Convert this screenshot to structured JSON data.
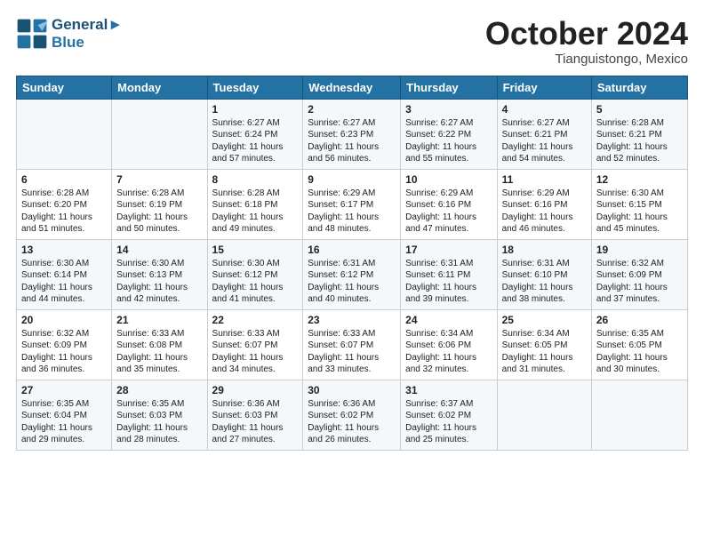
{
  "header": {
    "logo_line1": "General",
    "logo_line2": "Blue",
    "month_title": "October 2024",
    "location": "Tianguistongo, Mexico"
  },
  "weekdays": [
    "Sunday",
    "Monday",
    "Tuesday",
    "Wednesday",
    "Thursday",
    "Friday",
    "Saturday"
  ],
  "weeks": [
    [
      {
        "day": "",
        "sunrise": "",
        "sunset": "",
        "daylight": ""
      },
      {
        "day": "",
        "sunrise": "",
        "sunset": "",
        "daylight": ""
      },
      {
        "day": "1",
        "sunrise": "Sunrise: 6:27 AM",
        "sunset": "Sunset: 6:24 PM",
        "daylight": "Daylight: 11 hours and 57 minutes."
      },
      {
        "day": "2",
        "sunrise": "Sunrise: 6:27 AM",
        "sunset": "Sunset: 6:23 PM",
        "daylight": "Daylight: 11 hours and 56 minutes."
      },
      {
        "day": "3",
        "sunrise": "Sunrise: 6:27 AM",
        "sunset": "Sunset: 6:22 PM",
        "daylight": "Daylight: 11 hours and 55 minutes."
      },
      {
        "day": "4",
        "sunrise": "Sunrise: 6:27 AM",
        "sunset": "Sunset: 6:21 PM",
        "daylight": "Daylight: 11 hours and 54 minutes."
      },
      {
        "day": "5",
        "sunrise": "Sunrise: 6:28 AM",
        "sunset": "Sunset: 6:21 PM",
        "daylight": "Daylight: 11 hours and 52 minutes."
      }
    ],
    [
      {
        "day": "6",
        "sunrise": "Sunrise: 6:28 AM",
        "sunset": "Sunset: 6:20 PM",
        "daylight": "Daylight: 11 hours and 51 minutes."
      },
      {
        "day": "7",
        "sunrise": "Sunrise: 6:28 AM",
        "sunset": "Sunset: 6:19 PM",
        "daylight": "Daylight: 11 hours and 50 minutes."
      },
      {
        "day": "8",
        "sunrise": "Sunrise: 6:28 AM",
        "sunset": "Sunset: 6:18 PM",
        "daylight": "Daylight: 11 hours and 49 minutes."
      },
      {
        "day": "9",
        "sunrise": "Sunrise: 6:29 AM",
        "sunset": "Sunset: 6:17 PM",
        "daylight": "Daylight: 11 hours and 48 minutes."
      },
      {
        "day": "10",
        "sunrise": "Sunrise: 6:29 AM",
        "sunset": "Sunset: 6:16 PM",
        "daylight": "Daylight: 11 hours and 47 minutes."
      },
      {
        "day": "11",
        "sunrise": "Sunrise: 6:29 AM",
        "sunset": "Sunset: 6:16 PM",
        "daylight": "Daylight: 11 hours and 46 minutes."
      },
      {
        "day": "12",
        "sunrise": "Sunrise: 6:30 AM",
        "sunset": "Sunset: 6:15 PM",
        "daylight": "Daylight: 11 hours and 45 minutes."
      }
    ],
    [
      {
        "day": "13",
        "sunrise": "Sunrise: 6:30 AM",
        "sunset": "Sunset: 6:14 PM",
        "daylight": "Daylight: 11 hours and 44 minutes."
      },
      {
        "day": "14",
        "sunrise": "Sunrise: 6:30 AM",
        "sunset": "Sunset: 6:13 PM",
        "daylight": "Daylight: 11 hours and 42 minutes."
      },
      {
        "day": "15",
        "sunrise": "Sunrise: 6:30 AM",
        "sunset": "Sunset: 6:12 PM",
        "daylight": "Daylight: 11 hours and 41 minutes."
      },
      {
        "day": "16",
        "sunrise": "Sunrise: 6:31 AM",
        "sunset": "Sunset: 6:12 PM",
        "daylight": "Daylight: 11 hours and 40 minutes."
      },
      {
        "day": "17",
        "sunrise": "Sunrise: 6:31 AM",
        "sunset": "Sunset: 6:11 PM",
        "daylight": "Daylight: 11 hours and 39 minutes."
      },
      {
        "day": "18",
        "sunrise": "Sunrise: 6:31 AM",
        "sunset": "Sunset: 6:10 PM",
        "daylight": "Daylight: 11 hours and 38 minutes."
      },
      {
        "day": "19",
        "sunrise": "Sunrise: 6:32 AM",
        "sunset": "Sunset: 6:09 PM",
        "daylight": "Daylight: 11 hours and 37 minutes."
      }
    ],
    [
      {
        "day": "20",
        "sunrise": "Sunrise: 6:32 AM",
        "sunset": "Sunset: 6:09 PM",
        "daylight": "Daylight: 11 hours and 36 minutes."
      },
      {
        "day": "21",
        "sunrise": "Sunrise: 6:33 AM",
        "sunset": "Sunset: 6:08 PM",
        "daylight": "Daylight: 11 hours and 35 minutes."
      },
      {
        "day": "22",
        "sunrise": "Sunrise: 6:33 AM",
        "sunset": "Sunset: 6:07 PM",
        "daylight": "Daylight: 11 hours and 34 minutes."
      },
      {
        "day": "23",
        "sunrise": "Sunrise: 6:33 AM",
        "sunset": "Sunset: 6:07 PM",
        "daylight": "Daylight: 11 hours and 33 minutes."
      },
      {
        "day": "24",
        "sunrise": "Sunrise: 6:34 AM",
        "sunset": "Sunset: 6:06 PM",
        "daylight": "Daylight: 11 hours and 32 minutes."
      },
      {
        "day": "25",
        "sunrise": "Sunrise: 6:34 AM",
        "sunset": "Sunset: 6:05 PM",
        "daylight": "Daylight: 11 hours and 31 minutes."
      },
      {
        "day": "26",
        "sunrise": "Sunrise: 6:35 AM",
        "sunset": "Sunset: 6:05 PM",
        "daylight": "Daylight: 11 hours and 30 minutes."
      }
    ],
    [
      {
        "day": "27",
        "sunrise": "Sunrise: 6:35 AM",
        "sunset": "Sunset: 6:04 PM",
        "daylight": "Daylight: 11 hours and 29 minutes."
      },
      {
        "day": "28",
        "sunrise": "Sunrise: 6:35 AM",
        "sunset": "Sunset: 6:03 PM",
        "daylight": "Daylight: 11 hours and 28 minutes."
      },
      {
        "day": "29",
        "sunrise": "Sunrise: 6:36 AM",
        "sunset": "Sunset: 6:03 PM",
        "daylight": "Daylight: 11 hours and 27 minutes."
      },
      {
        "day": "30",
        "sunrise": "Sunrise: 6:36 AM",
        "sunset": "Sunset: 6:02 PM",
        "daylight": "Daylight: 11 hours and 26 minutes."
      },
      {
        "day": "31",
        "sunrise": "Sunrise: 6:37 AM",
        "sunset": "Sunset: 6:02 PM",
        "daylight": "Daylight: 11 hours and 25 minutes."
      },
      {
        "day": "",
        "sunrise": "",
        "sunset": "",
        "daylight": ""
      },
      {
        "day": "",
        "sunrise": "",
        "sunset": "",
        "daylight": ""
      }
    ]
  ]
}
